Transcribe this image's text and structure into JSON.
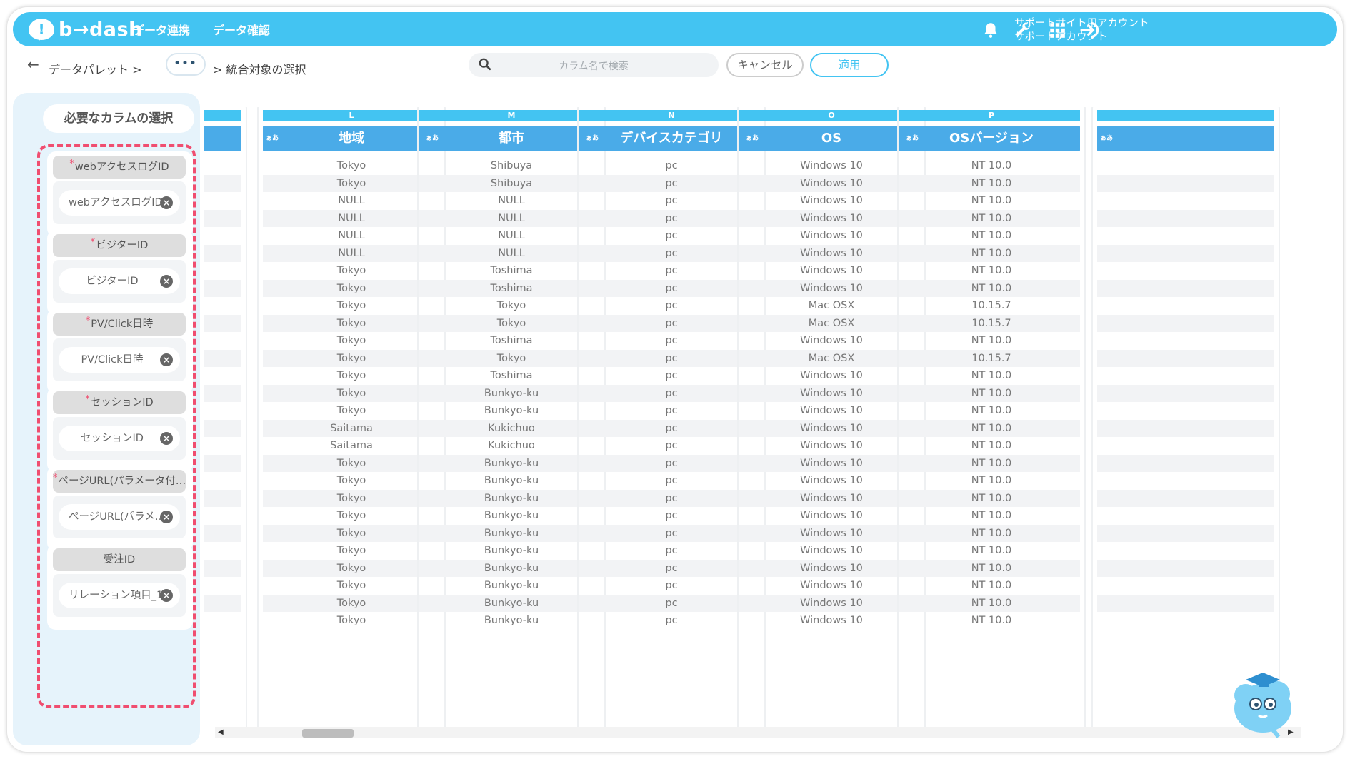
{
  "app": {
    "logo_text": "b→dash",
    "logo_mark": "!"
  },
  "nav": [
    "データ連携",
    "データ確認"
  ],
  "account": {
    "line1": "サポートサイト用アカウント",
    "line2": "サポートアカウント"
  },
  "icons": [
    "bell-icon",
    "wrench-icon",
    "apps-grid-icon",
    "logout-icon",
    "search-icon",
    "back-arrow-icon",
    "close-icon"
  ],
  "breadcrumb": {
    "back": "←",
    "root": "データパレット >",
    "more": "•••",
    "current": "> 統合対象の選択"
  },
  "search": {
    "placeholder": "カラム名で検索"
  },
  "buttons": {
    "cancel": "キャンセル",
    "apply": "適用"
  },
  "left_panel": {
    "title": "必要なカラムの選択",
    "required_mark": "*",
    "cards": [
      {
        "required": true,
        "head": "webアクセスログID",
        "value": "webアクセスログID"
      },
      {
        "required": true,
        "head": "ビジターID",
        "value": "ビジターID"
      },
      {
        "required": true,
        "head": "PV/Click日時",
        "value": "PV/Click日時"
      },
      {
        "required": true,
        "head": "セッションID",
        "value": "セッションID"
      },
      {
        "required": true,
        "head": "ページURL(パラメータ付…",
        "value": "ページURL(パラメ…"
      },
      {
        "required": false,
        "head": "受注ID",
        "value": "リレーション項目_1"
      }
    ]
  },
  "grid": {
    "type_tag": "ぁあ",
    "columns": [
      {
        "letter": "L",
        "name": "地域",
        "values": [
          "Tokyo",
          "Tokyo",
          "NULL",
          "NULL",
          "NULL",
          "NULL",
          "Tokyo",
          "Tokyo",
          "Tokyo",
          "Tokyo",
          "Tokyo",
          "Tokyo",
          "Tokyo",
          "Tokyo",
          "Tokyo",
          "Saitama",
          "Saitama",
          "Tokyo",
          "Tokyo",
          "Tokyo",
          "Tokyo",
          "Tokyo",
          "Tokyo",
          "Tokyo",
          "Tokyo",
          "Tokyo",
          "Tokyo"
        ]
      },
      {
        "letter": "M",
        "name": "都市",
        "values": [
          "Shibuya",
          "Shibuya",
          "NULL",
          "NULL",
          "NULL",
          "NULL",
          "Toshima",
          "Toshima",
          "Tokyo",
          "Tokyo",
          "Toshima",
          "Tokyo",
          "Toshima",
          "Bunkyo-ku",
          "Bunkyo-ku",
          "Kukichuo",
          "Kukichuo",
          "Bunkyo-ku",
          "Bunkyo-ku",
          "Bunkyo-ku",
          "Bunkyo-ku",
          "Bunkyo-ku",
          "Bunkyo-ku",
          "Bunkyo-ku",
          "Bunkyo-ku",
          "Bunkyo-ku",
          "Bunkyo-ku"
        ]
      },
      {
        "letter": "N",
        "name": "デバイスカテゴリ",
        "values": [
          "pc",
          "pc",
          "pc",
          "pc",
          "pc",
          "pc",
          "pc",
          "pc",
          "pc",
          "pc",
          "pc",
          "pc",
          "pc",
          "pc",
          "pc",
          "pc",
          "pc",
          "pc",
          "pc",
          "pc",
          "pc",
          "pc",
          "pc",
          "pc",
          "pc",
          "pc",
          "pc"
        ]
      },
      {
        "letter": "O",
        "name": "OS",
        "values": [
          "Windows 10",
          "Windows 10",
          "Windows 10",
          "Windows 10",
          "Windows 10",
          "Windows 10",
          "Windows 10",
          "Windows 10",
          "Mac OSX",
          "Mac OSX",
          "Windows 10",
          "Mac OSX",
          "Windows 10",
          "Windows 10",
          "Windows 10",
          "Windows 10",
          "Windows 10",
          "Windows 10",
          "Windows 10",
          "Windows 10",
          "Windows 10",
          "Windows 10",
          "Windows 10",
          "Windows 10",
          "Windows 10",
          "Windows 10",
          "Windows 10"
        ]
      },
      {
        "letter": "P",
        "name": "OSバージョン",
        "values": [
          "NT 10.0",
          "NT 10.0",
          "NT 10.0",
          "NT 10.0",
          "NT 10.0",
          "NT 10.0",
          "NT 10.0",
          "NT 10.0",
          "10.15.7",
          "10.15.7",
          "NT 10.0",
          "10.15.7",
          "NT 10.0",
          "NT 10.0",
          "NT 10.0",
          "NT 10.0",
          "NT 10.0",
          "NT 10.0",
          "NT 10.0",
          "NT 10.0",
          "NT 10.0",
          "NT 10.0",
          "NT 10.0",
          "NT 10.0",
          "NT 10.0",
          "NT 10.0",
          "NT 10.0"
        ]
      }
    ]
  },
  "colors": {
    "primary": "#43c4f2",
    "header": "#4aabe8",
    "required": "#f04e70"
  }
}
